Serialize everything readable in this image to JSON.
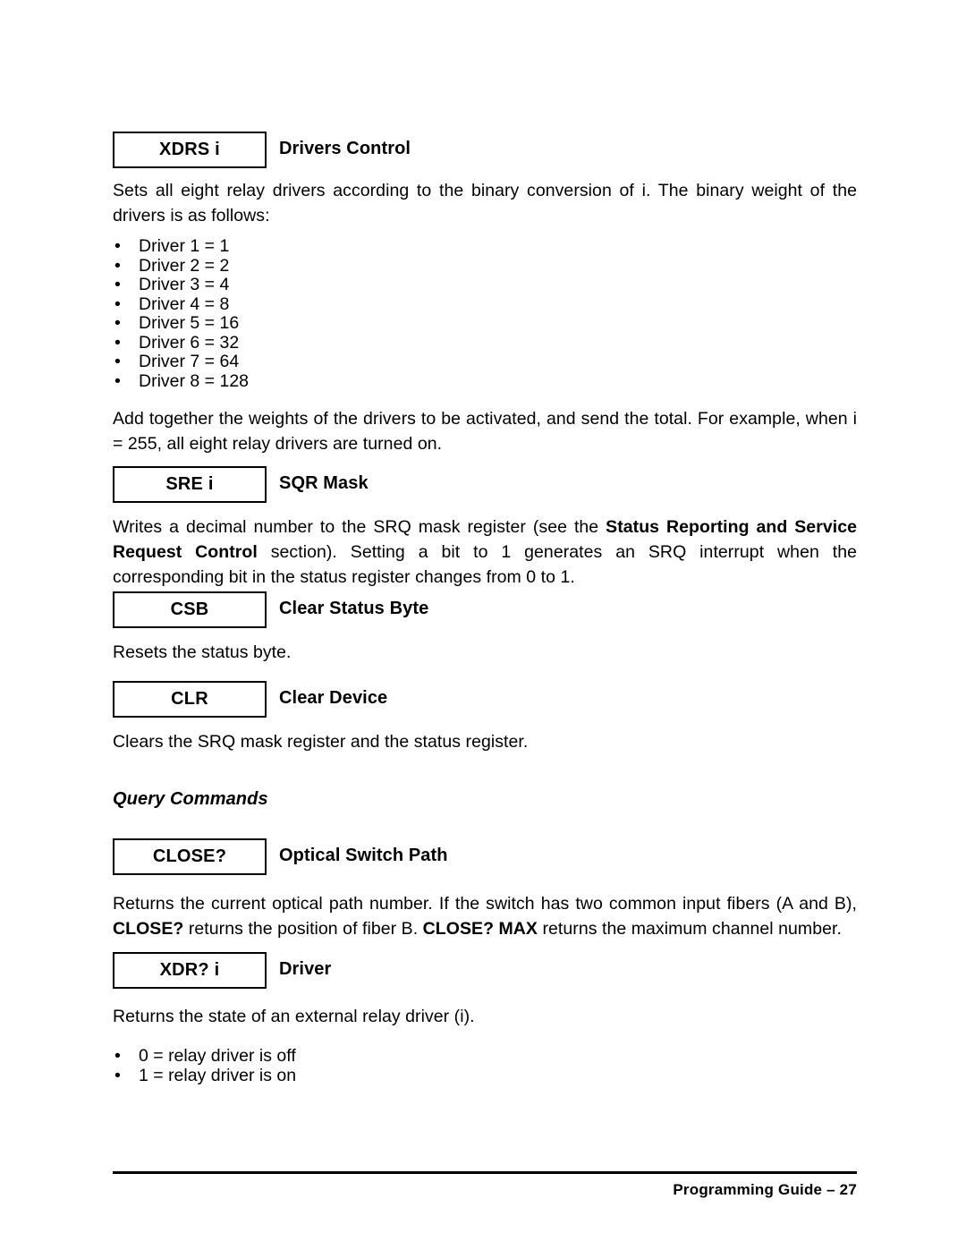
{
  "document": {
    "footer": {
      "text": "Programming Guide  –  27"
    }
  },
  "sections": [
    {
      "command": "XDRS i",
      "title": "Drivers Control",
      "intro": "Sets all eight relay drivers according to the binary conversion of i. The binary weight of the drivers is as follows:",
      "list": [
        "Driver 1 = 1",
        "Driver 2 = 2",
        "Driver 3 = 4",
        "Driver 4 = 8",
        "Driver 5 = 16",
        "Driver 6 = 32",
        "Driver 7 = 64",
        "Driver 8 = 128"
      ],
      "outro": "Add together the weights of the drivers to be activated, and send the total. For example, when i = 255, all eight relay drivers are turned on."
    },
    {
      "command": "SRE i",
      "title": "SQR Mask",
      "body_part1": "Writes a decimal number to the SRQ mask register (see the ",
      "body_bold1": "Status Reporting and Service Request Control",
      "body_part2": " section). Setting a bit to 1 generates an SRQ interrupt when the corresponding bit in the status register changes from 0 to 1."
    },
    {
      "command": "CSB",
      "title": "Clear Status Byte",
      "body": "Resets the status byte."
    },
    {
      "command": "CLR",
      "title": "Clear Device",
      "body": "Clears the SRQ mask register and the status register."
    }
  ],
  "query_section": {
    "heading": "Query Commands",
    "sections": [
      {
        "command": "CLOSE?",
        "title": "Optical Switch Path",
        "body_part1": "Returns the current optical path number. If the switch has two common input fibers (A and B), ",
        "body_bold1": "CLOSE?",
        "body_part2": " returns the position of fiber B. ",
        "body_bold2": "CLOSE? MAX",
        "body_part3": " returns the maximum channel number."
      },
      {
        "command": "XDR? i",
        "title": "Driver",
        "body": "Returns the state of an external relay driver (i).",
        "list": [
          "0 = relay driver is off",
          "1 = relay driver is on"
        ]
      }
    ]
  },
  "bullet_glyph": "•"
}
